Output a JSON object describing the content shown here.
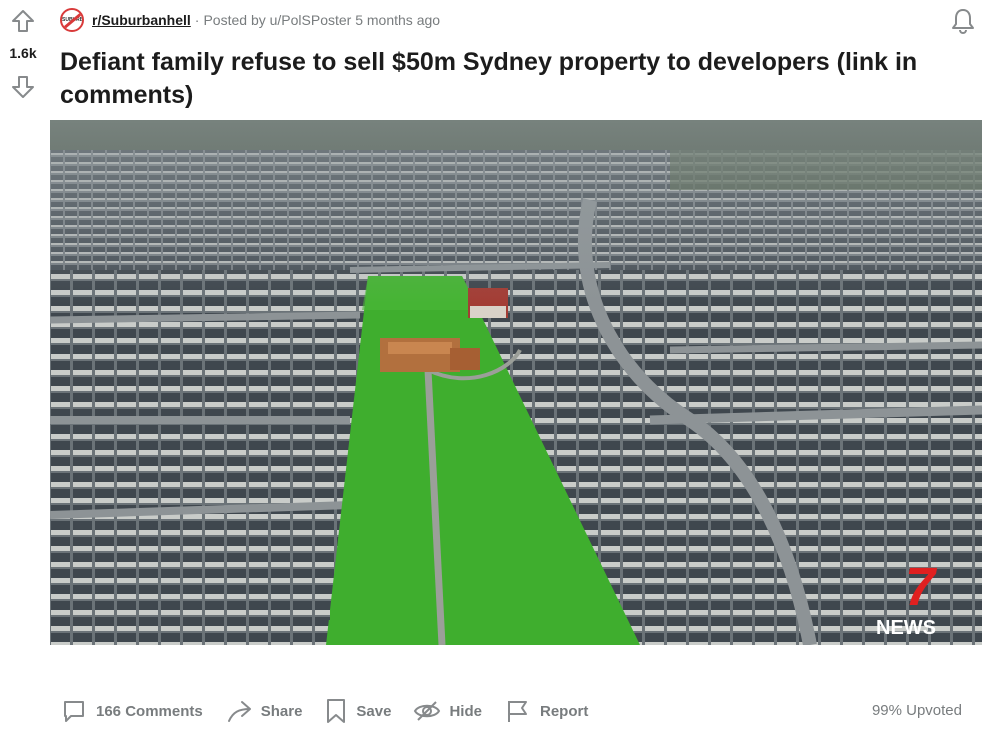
{
  "vote": {
    "count": "1.6k"
  },
  "post": {
    "subreddit": "r/Suburbanhell",
    "subreddit_icon_text": "SUBURBS",
    "separator": "·",
    "posted_by": "Posted by u/PolSPoster 5 months ago",
    "title": "Defiant family refuse to sell $50m Sydney property to developers (link in comments)"
  },
  "media": {
    "watermark_number": "7",
    "watermark_text": "NEWS"
  },
  "actions": {
    "comments": "166 Comments",
    "share": "Share",
    "save": "Save",
    "hide": "Hide",
    "report": "Report"
  },
  "upvoted": "99% Upvoted",
  "colors": {
    "accent": "#d93a3a",
    "meta_gray": "#787c7e",
    "grass": "#3fae2e"
  }
}
